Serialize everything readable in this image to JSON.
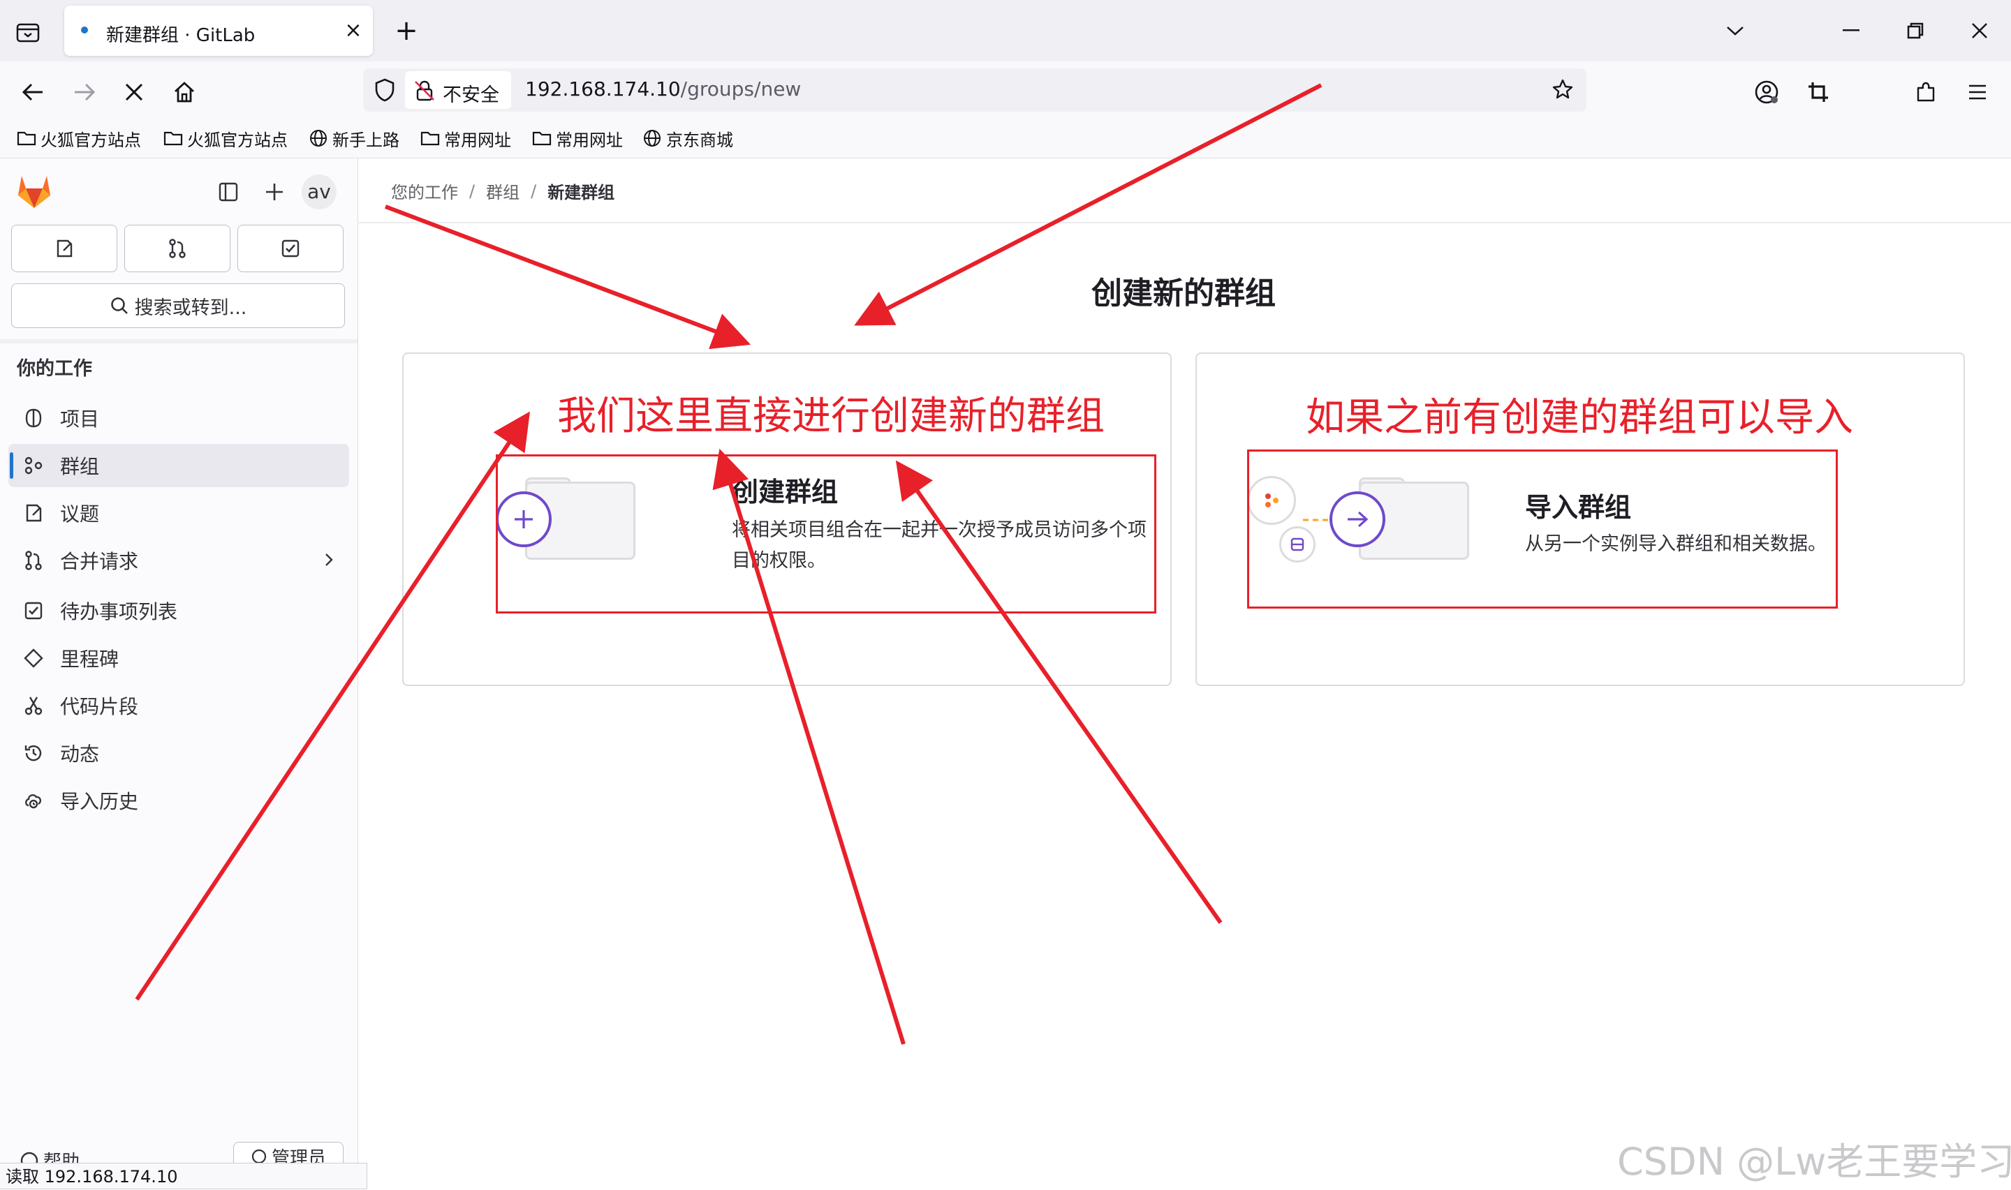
{
  "browser": {
    "tab_title": "新建群组 · GitLab",
    "url_insecure_label": "不安全",
    "url_host": "192.168.174.10",
    "url_path": "/groups/new",
    "bookmarks": [
      "火狐官方站点",
      "火狐官方站点",
      "新手上路",
      "常用网址",
      "常用网址",
      "京东商城"
    ],
    "status_text": "读取 192.168.174.10",
    "accent_color": "#1f75cb"
  },
  "sidebar": {
    "avatar_text": "av",
    "search_label": "搜索或转到...",
    "section_heading": "你的工作",
    "items": [
      {
        "label": "项目",
        "icon": "project-icon"
      },
      {
        "label": "群组",
        "icon": "group-icon",
        "active": true
      },
      {
        "label": "议题",
        "icon": "issues-icon"
      },
      {
        "label": "合并请求",
        "icon": "merge-request-icon"
      },
      {
        "label": "待办事项列表",
        "icon": "todo-icon"
      },
      {
        "label": "里程碑",
        "icon": "milestone-icon"
      },
      {
        "label": "代码片段",
        "icon": "snippet-icon"
      },
      {
        "label": "动态",
        "icon": "history-icon"
      },
      {
        "label": "导入历史",
        "icon": "import-history-icon"
      }
    ],
    "help_label": "帮助",
    "admin_label": "管理员"
  },
  "breadcrumb": [
    "您的工作",
    "群组",
    "新建群组"
  ],
  "page_title": "创建新的群组",
  "cards": {
    "create": {
      "title": "创建群组",
      "description": "将相关项目组合在一起并一次授予成员访问多个项目的权限。"
    },
    "import": {
      "title": "导入群组",
      "description": "从另一个实例导入群组和相关数据。"
    }
  },
  "annotations": {
    "left": "我们这里直接进行创建新的群组",
    "right": "如果之前有创建的群组可以导入",
    "color": "#e8202a"
  },
  "watermark": "CSDN @Lw老王要学习"
}
